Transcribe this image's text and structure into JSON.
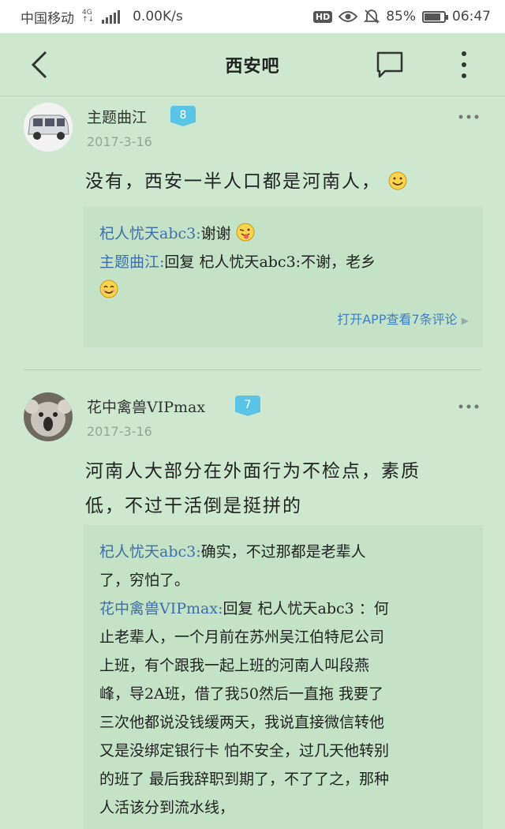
{
  "status_bar": {
    "carrier": "中国移动",
    "network": "4G",
    "network_sub": "↑↓",
    "speed": "0.00K/s",
    "hd": "HD",
    "battery": "85%",
    "battery_level": 0.85,
    "time": "06:47"
  },
  "header": {
    "title": "西安吧",
    "icons": [
      "back-arrow-icon",
      "comment-icon",
      "more-vertical-icon"
    ]
  },
  "posts": [
    {
      "username": "主题曲江",
      "level": "8",
      "date": "2017-3-16",
      "text": "没有，西安一半人口都是河南人，",
      "text_emoji": "smile-emoji",
      "replies": [
        {
          "author": "杞人忧天abc3:",
          "text": "谢谢",
          "emoji": "wink-tongue-emoji"
        },
        {
          "author": "主题曲江:",
          "text": "回复 杞人忧天abc3:不谢，老乡",
          "emoji": "smile-emoji"
        }
      ],
      "view_more": "打开APP查看7条评论"
    },
    {
      "username": "花中禽兽VIPmax",
      "level": "7",
      "date": "2017-3-16",
      "text_lines": [
        "河南人大部分在外面行为不检点，素质",
        "低，不过干活倒是挺拼的"
      ],
      "replies": [
        {
          "author": "杞人忧天abc3:",
          "lines": [
            "确实，不过那都是老辈人",
            "了，穷怕了。"
          ]
        },
        {
          "author": "花中禽兽VIPmax:",
          "lines": [
            "回复 杞人忧天abc3 ：何",
            "止老辈人，一个月前在苏州吴江伯特尼公司",
            "上班，有个跟我一起上班的河南人叫段燕",
            "峰，导2A班，借了我50然后一直拖 我要了",
            "三次他都说没钱缓两天，我说直接微信转他",
            "又是没绑定银行卡 怕不安全，过几天他转别",
            "的班了 最后我辞职到期了，不了了之，那种",
            "人活该分到流水线，"
          ]
        }
      ]
    }
  ]
}
